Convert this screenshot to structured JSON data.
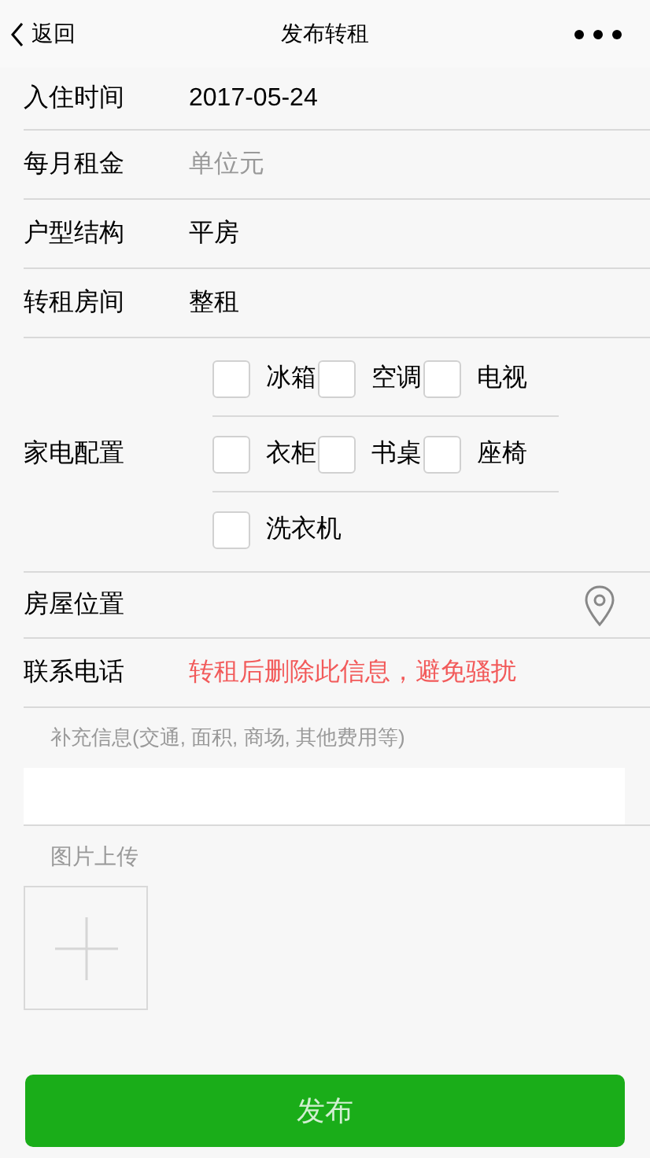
{
  "header": {
    "back_label": "返回",
    "title": "发布转租"
  },
  "fields": [
    {
      "kind": "value",
      "label": "入住时间",
      "value": "2017-05-24"
    },
    {
      "kind": "input",
      "label": "每月租金",
      "placeholder": "单位元"
    },
    {
      "kind": "value",
      "label": "户型结构",
      "value": "平房"
    },
    {
      "kind": "value",
      "label": "转租房间",
      "value": "整租"
    },
    {
      "kind": "checkboxes",
      "label": "家电配置",
      "items": [
        {
          "label": "冰箱",
          "checked": false
        },
        {
          "label": "空调",
          "checked": false
        },
        {
          "label": "电视",
          "checked": false
        },
        {
          "label": "衣柜",
          "checked": false
        },
        {
          "label": "书桌",
          "checked": false
        },
        {
          "label": "座椅",
          "checked": false
        },
        {
          "label": "洗衣机",
          "checked": false
        }
      ]
    },
    {
      "kind": "location",
      "label": "房屋位置"
    },
    {
      "kind": "notice",
      "label": "联系电话",
      "value": "转租后删除此信息，避免骚扰"
    }
  ],
  "extra_info": {
    "label": "补充信息(交通, 面积, 商场, 其他费用等)"
  },
  "upload": {
    "label": "图片上传"
  },
  "submit_button": "发布"
}
